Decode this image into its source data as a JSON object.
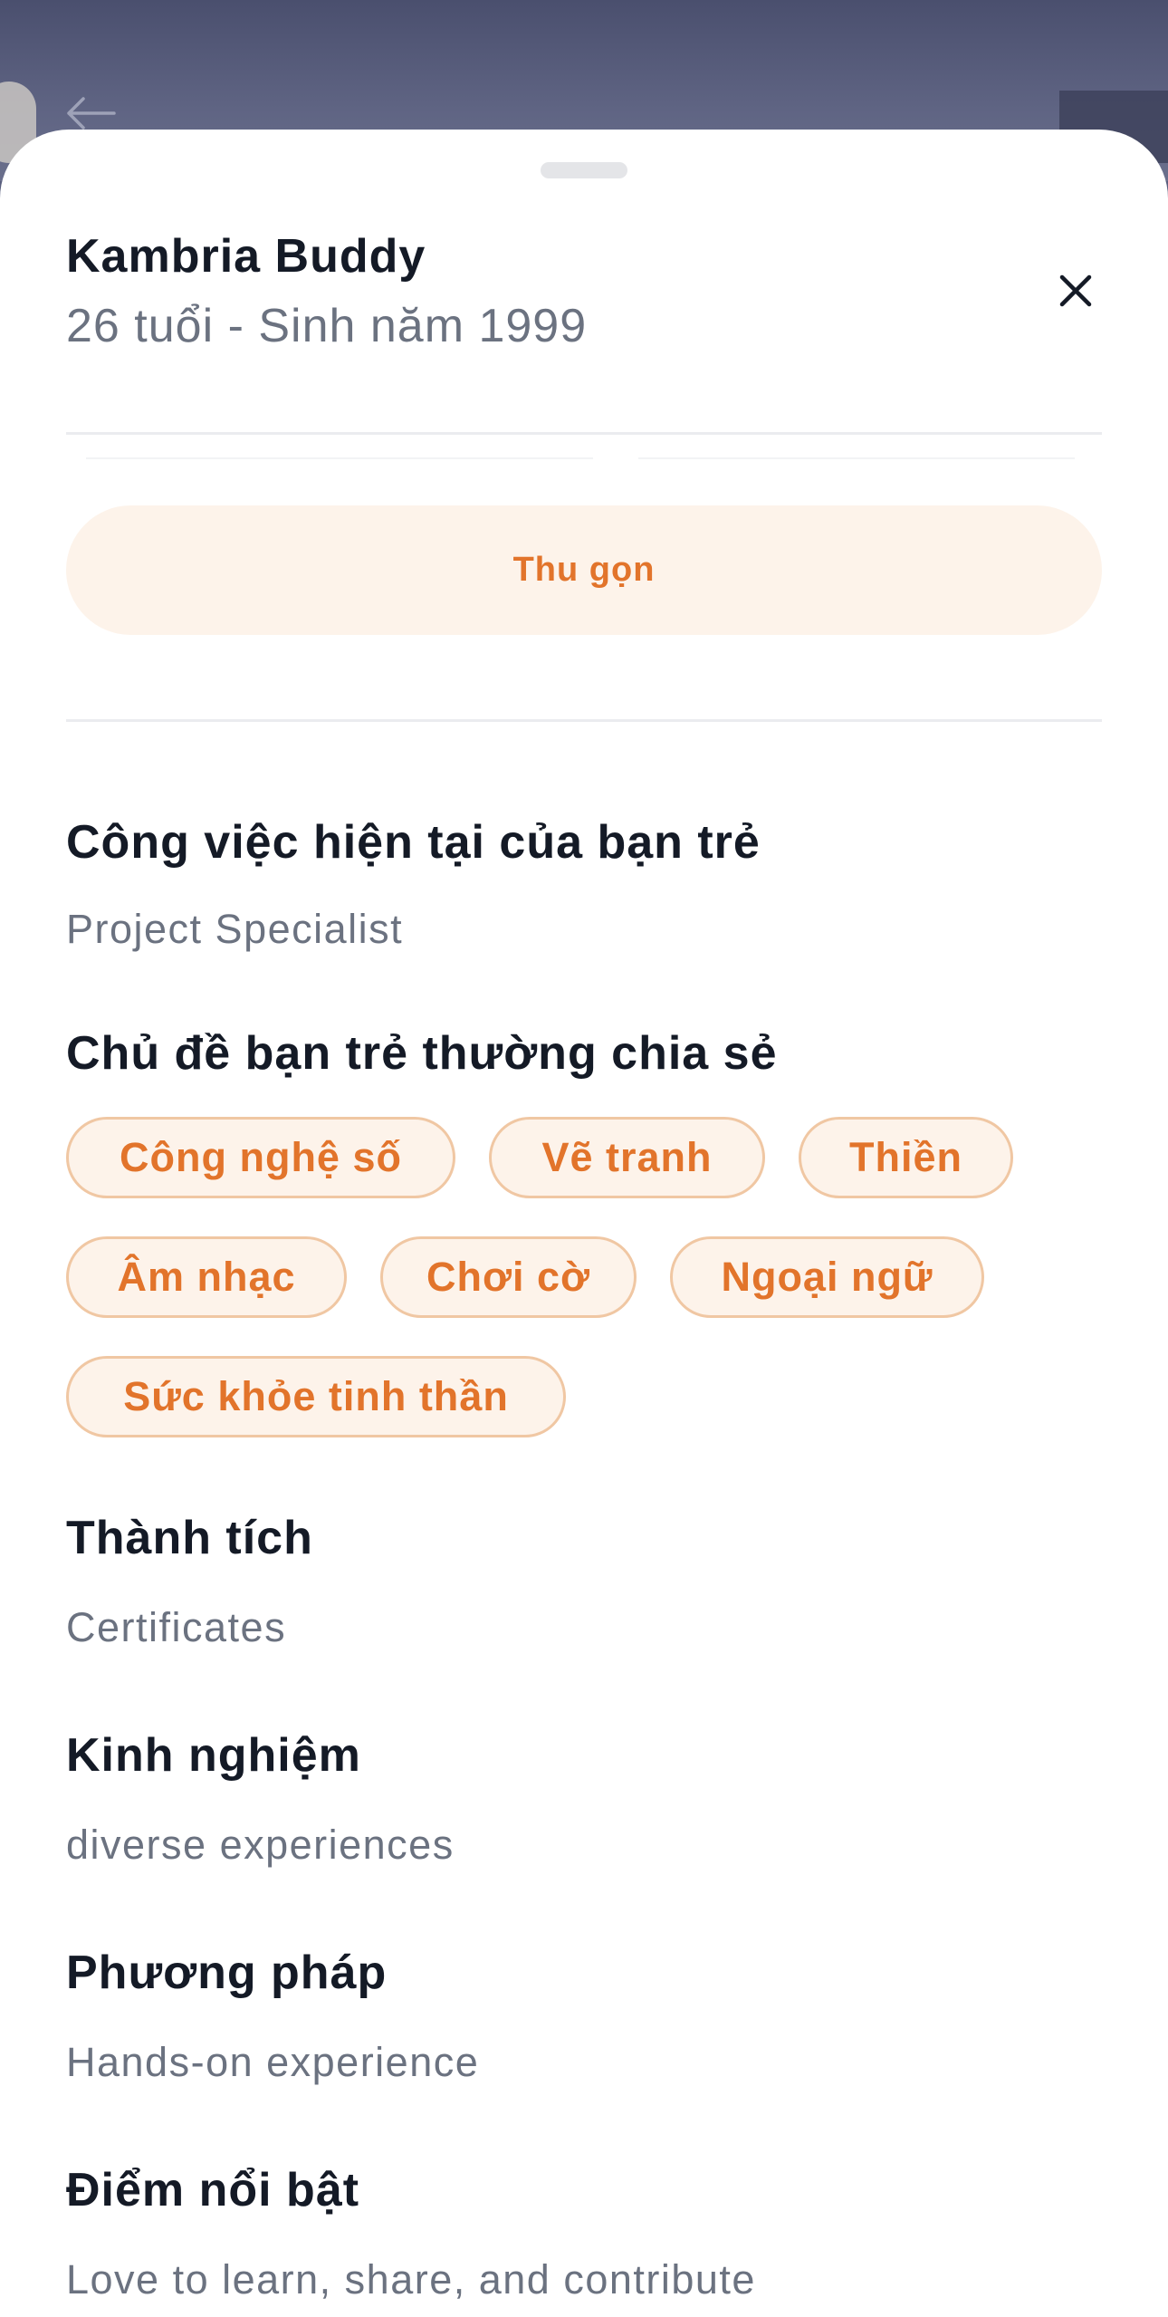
{
  "profile": {
    "name": "Kambria Buddy",
    "age_line": "26 tuổi - Sinh năm 1999"
  },
  "actions": {
    "collapse_label": "Thu gọn"
  },
  "job": {
    "title": "Công việc hiện tại của bạn trẻ",
    "value": "Project Specialist"
  },
  "topics": {
    "title": "Chủ đề bạn trẻ thường chia sẻ",
    "tags": [
      "Công nghệ số",
      "Vẽ tranh",
      "Thiền",
      "Âm nhạc",
      "Chơi cờ",
      "Ngoại ngữ",
      "Sức khỏe tinh thần"
    ]
  },
  "achievements": {
    "title": "Thành tích",
    "value": "Certificates"
  },
  "experience": {
    "title": "Kinh nghiệm",
    "value": "diverse experiences"
  },
  "method": {
    "title": "Phương pháp",
    "value": "Hands-on experience"
  },
  "highlight": {
    "title": "Điểm nổi bật",
    "value": "Love to learn, share, and contribute"
  },
  "icons": {
    "back": "arrow-left-icon",
    "close": "close-icon"
  },
  "colors": {
    "accent": "#e2742b",
    "accent_bg": "#fdf3ea",
    "chip_border": "#f0c7a3",
    "title_text": "#141a26",
    "secondary_text": "#6b7280"
  }
}
